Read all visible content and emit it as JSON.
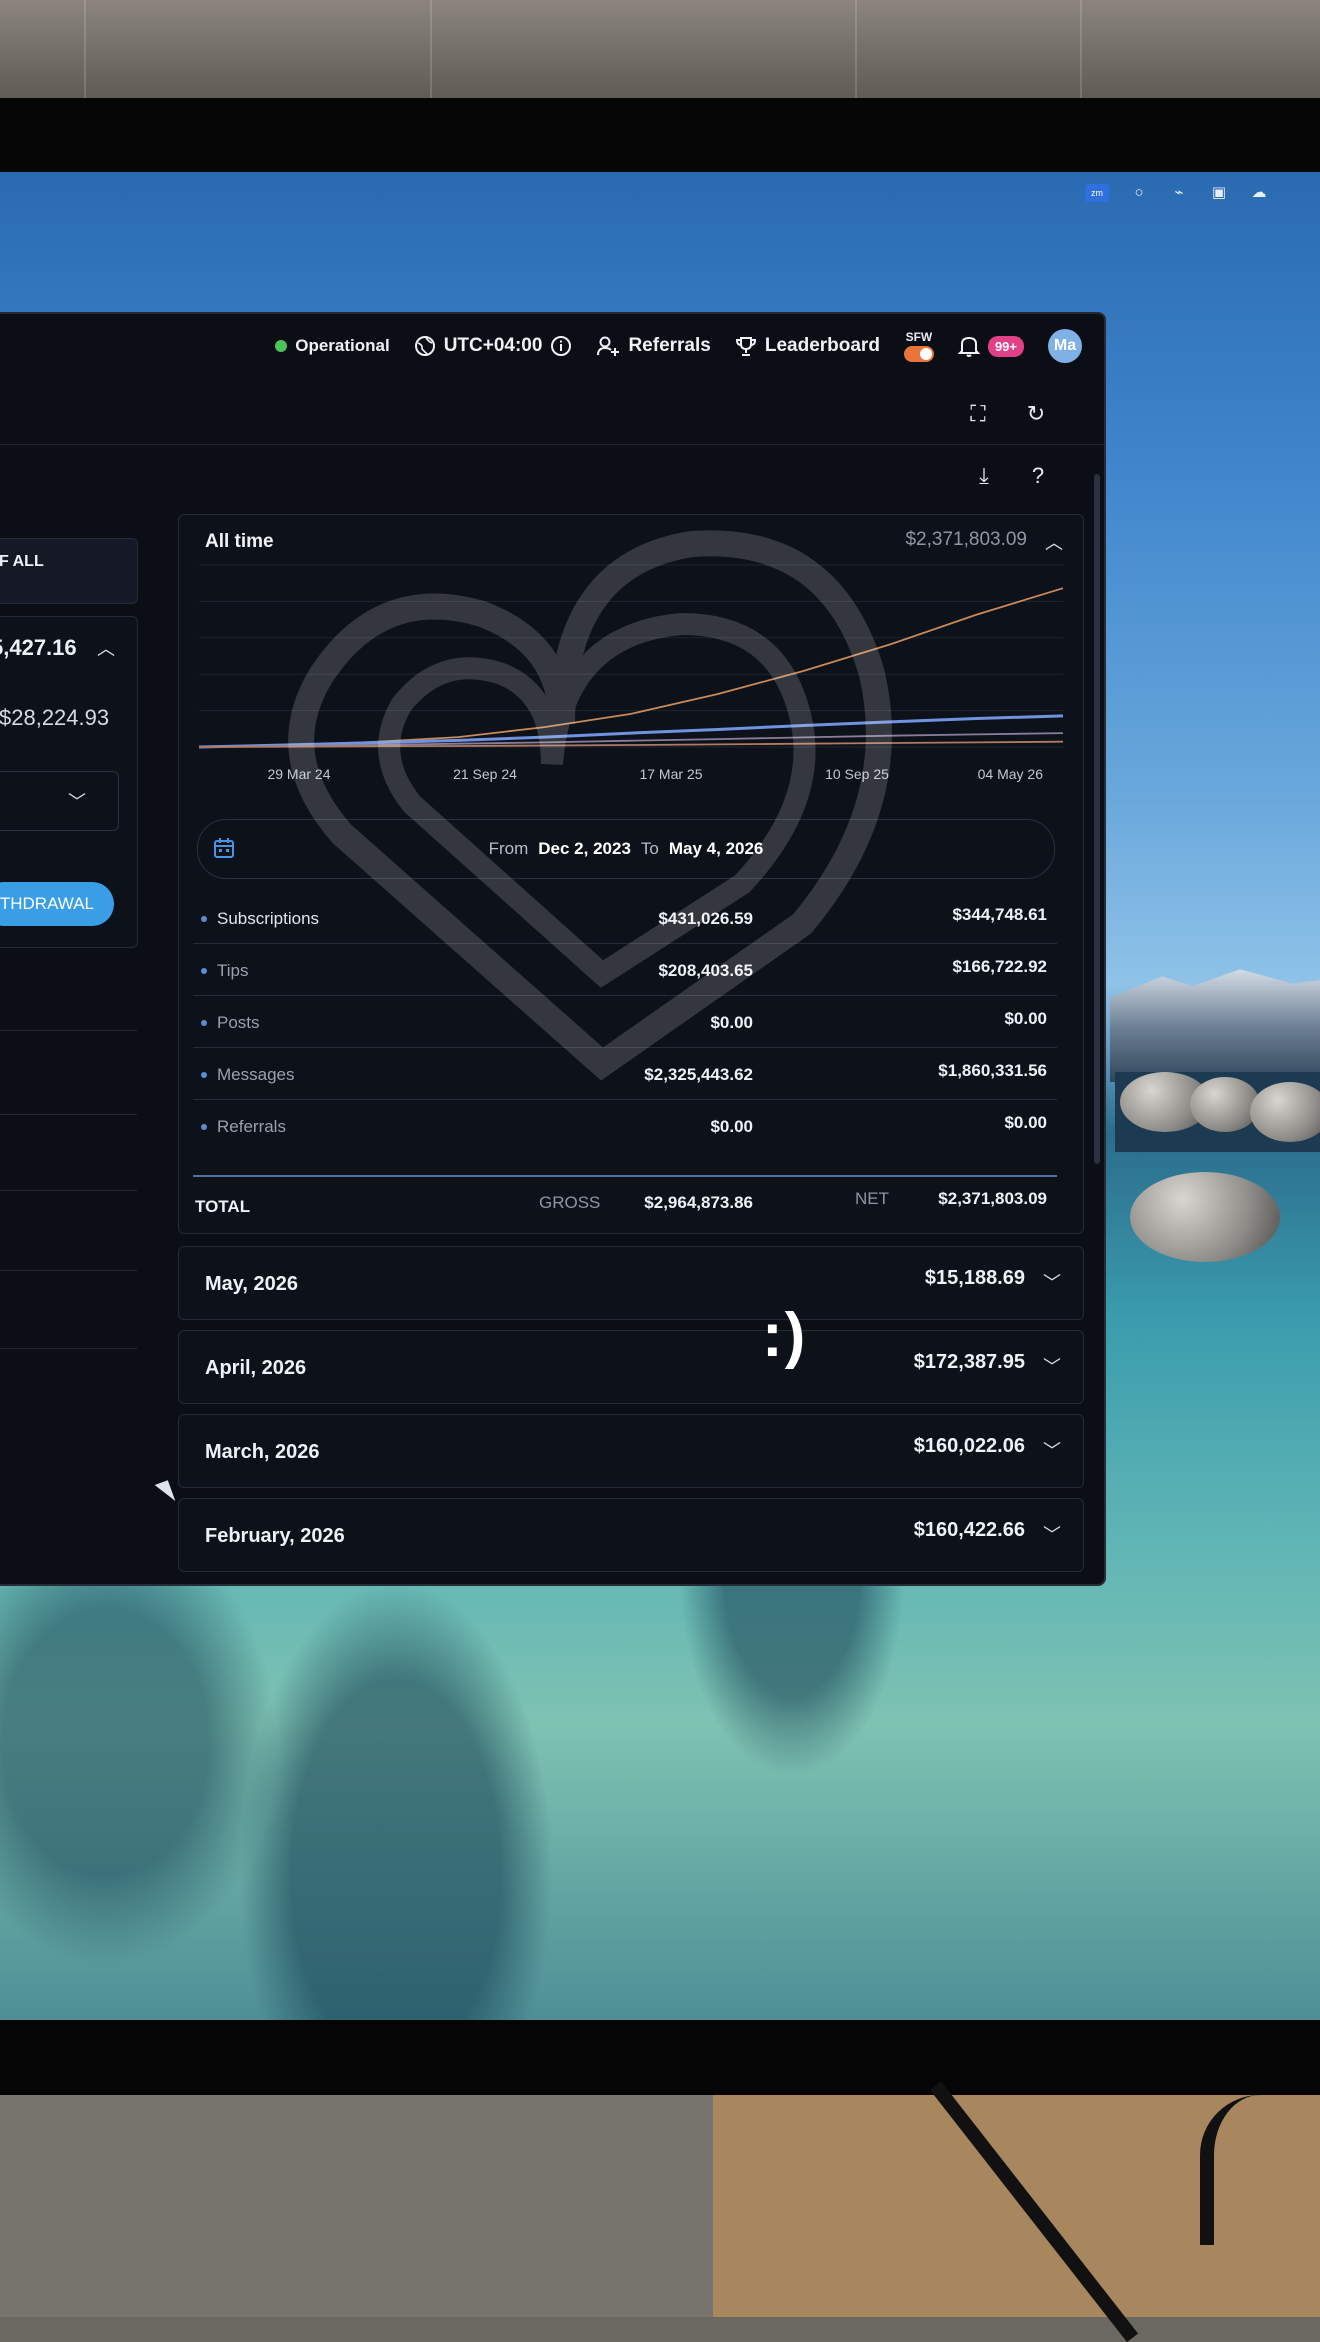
{
  "tray": {
    "zm_label": "zm"
  },
  "topbar": {
    "status": "Operational",
    "timezone": "UTC+04:00",
    "referrals": "Referrals",
    "leaderboard": "Leaderboard",
    "sfw": "SFW",
    "notifications": "99+",
    "avatar": "Ma"
  },
  "left_panel": {
    "filter_label": "F ALL",
    "balance": "5,427.16",
    "pending": "$28,224.93",
    "withdraw_label": "ITHDRAWAL"
  },
  "statement": {
    "title": "All time",
    "total": "$2,371,803.09",
    "date_range": {
      "from_label": "From",
      "from": "Dec 2, 2023",
      "to_label": "To",
      "to": "May 4, 2026"
    },
    "rows": [
      {
        "label": "Subscriptions",
        "gross": "$431,026.59",
        "net": "$344,748.61"
      },
      {
        "label": "Tips",
        "gross": "$208,403.65",
        "net": "$166,722.92"
      },
      {
        "label": "Posts",
        "gross": "$0.00",
        "net": "$0.00"
      },
      {
        "label": "Messages",
        "gross": "$2,325,443.62",
        "net": "$1,860,331.56"
      },
      {
        "label": "Referrals",
        "gross": "$0.00",
        "net": "$0.00"
      }
    ],
    "total_row": {
      "label": "TOTAL",
      "gross_label": "GROSS",
      "gross": "$2,964,873.86",
      "net_label": "NET",
      "net": "$2,371,803.09"
    }
  },
  "chart_data": {
    "type": "line",
    "x_ticks": [
      "29 Mar 24",
      "21 Sep 24",
      "17 Mar 25",
      "10 Sep 25",
      "04 May 26"
    ],
    "series": [
      {
        "color": "#c98a5a",
        "values": [
          0,
          0.5,
          1.5,
          3,
          6,
          10,
          16,
          23,
          31,
          40,
          48
        ]
      },
      {
        "color": "#6f93e0",
        "values": [
          0,
          0.6,
          1.3,
          2,
          3,
          4.2,
          5.3,
          6.5,
          7.6,
          8.6,
          9.4
        ]
      },
      {
        "color": "#8a7d9c",
        "values": [
          0,
          0.3,
          0.6,
          1,
          1.4,
          1.9,
          2.4,
          2.9,
          3.4,
          3.8,
          4.2
        ]
      },
      {
        "color": "#b07a63",
        "values": [
          0,
          0.1,
          0.2,
          0.3,
          0.45,
          0.6,
          0.8,
          1,
          1.2,
          1.4,
          1.6
        ]
      }
    ],
    "ylim": [
      0,
      55
    ],
    "grid": true
  },
  "months": [
    {
      "label": "May, 2026",
      "value": "$15,188.69"
    },
    {
      "label": "April, 2026",
      "value": "$172,387.95"
    },
    {
      "label": "March, 2026",
      "value": "$160,022.06"
    },
    {
      "label": "February, 2026",
      "value": "$160,422.66"
    }
  ],
  "overlay_text": ":)"
}
